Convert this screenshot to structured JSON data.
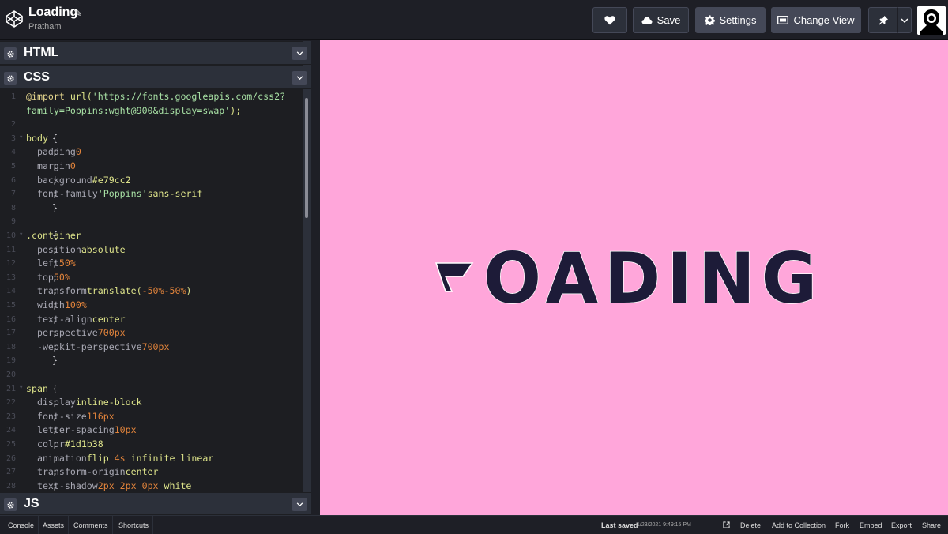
{
  "app": {
    "title": "Loading",
    "author": "Pratham"
  },
  "toolbar": {
    "save_label": "Save",
    "settings_label": "Settings",
    "change_view_label": "Change View"
  },
  "panels": {
    "html_label": "HTML",
    "css_label": "CSS",
    "js_label": "JS"
  },
  "css_code": [
    {
      "n": "1",
      "fold": "",
      "parts": [
        [
          "kw",
          "@import "
        ],
        [
          "sel",
          "url("
        ],
        [
          "str",
          "'https://fonts.googleapis.com/css2?"
        ]
      ]
    },
    {
      "n": "",
      "fold": "",
      "parts": [
        [
          "str",
          "family=Poppins:wght@900&display=swap'"
        ],
        [
          "sel",
          ");"
        ]
      ]
    },
    {
      "n": "2",
      "fold": "",
      "parts": []
    },
    {
      "n": "3",
      "fold": "▾",
      "parts": [
        [
          "sel",
          "body "
        ],
        [
          "txt",
          "{"
        ]
      ]
    },
    {
      "n": "4",
      "fold": "",
      "parts": [
        [
          "prop",
          "  padding"
        ],
        [
          "txt",
          ": "
        ],
        [
          "num",
          "0"
        ],
        [
          "txt",
          ";"
        ]
      ]
    },
    {
      "n": "5",
      "fold": "",
      "parts": [
        [
          "prop",
          "  margin"
        ],
        [
          "txt",
          ": "
        ],
        [
          "num",
          "0"
        ],
        [
          "txt",
          ";"
        ]
      ]
    },
    {
      "n": "6",
      "fold": "",
      "parts": [
        [
          "prop",
          "  background"
        ],
        [
          "txt",
          ": "
        ],
        [
          "sel",
          "#e79cc2"
        ],
        [
          "txt",
          ";"
        ]
      ]
    },
    {
      "n": "7",
      "fold": "",
      "parts": [
        [
          "prop",
          "  font-family"
        ],
        [
          "txt",
          ": "
        ],
        [
          "str",
          "'Poppins'"
        ],
        [
          "txt",
          ", "
        ],
        [
          "sel",
          "sans-serif"
        ],
        [
          "txt",
          ";"
        ]
      ]
    },
    {
      "n": "8",
      "fold": "",
      "parts": [
        [
          "txt",
          "}"
        ]
      ]
    },
    {
      "n": "9",
      "fold": "",
      "parts": []
    },
    {
      "n": "10",
      "fold": "▾",
      "parts": [
        [
          "sel",
          ".container "
        ],
        [
          "txt",
          "{"
        ]
      ]
    },
    {
      "n": "11",
      "fold": "",
      "parts": [
        [
          "prop",
          "  position"
        ],
        [
          "txt",
          ": "
        ],
        [
          "sel",
          "absolute"
        ],
        [
          "txt",
          ";"
        ]
      ]
    },
    {
      "n": "12",
      "fold": "",
      "parts": [
        [
          "prop",
          "  left"
        ],
        [
          "txt",
          ": "
        ],
        [
          "num",
          "50%"
        ],
        [
          "txt",
          ";"
        ]
      ]
    },
    {
      "n": "13",
      "fold": "",
      "parts": [
        [
          "prop",
          "  top"
        ],
        [
          "txt",
          ": "
        ],
        [
          "num",
          "50%"
        ],
        [
          "txt",
          ";"
        ]
      ]
    },
    {
      "n": "14",
      "fold": "",
      "parts": [
        [
          "prop",
          "  transform"
        ],
        [
          "txt",
          ": "
        ],
        [
          "sel",
          "translate("
        ],
        [
          "num",
          "-50%"
        ],
        [
          "txt",
          ", "
        ],
        [
          "num",
          "-50%"
        ],
        [
          "sel",
          ")"
        ],
        [
          "txt",
          ";"
        ]
      ]
    },
    {
      "n": "15",
      "fold": "",
      "parts": [
        [
          "prop",
          "  width"
        ],
        [
          "txt",
          ": "
        ],
        [
          "num",
          "100%"
        ],
        [
          "txt",
          ";"
        ]
      ]
    },
    {
      "n": "16",
      "fold": "",
      "parts": [
        [
          "prop",
          "  text-align"
        ],
        [
          "txt",
          ": "
        ],
        [
          "sel",
          "center"
        ],
        [
          "txt",
          ";"
        ]
      ]
    },
    {
      "n": "17",
      "fold": "",
      "parts": [
        [
          "prop",
          "  perspective"
        ],
        [
          "txt",
          ": "
        ],
        [
          "num",
          "700px"
        ],
        [
          "txt",
          ";"
        ]
      ]
    },
    {
      "n": "18",
      "fold": "",
      "parts": [
        [
          "prop",
          "  -webkit-perspective"
        ],
        [
          "txt",
          ": "
        ],
        [
          "num",
          "700px"
        ],
        [
          "txt",
          ";"
        ]
      ]
    },
    {
      "n": "19",
      "fold": "",
      "parts": [
        [
          "txt",
          "}"
        ]
      ]
    },
    {
      "n": "20",
      "fold": "",
      "parts": []
    },
    {
      "n": "21",
      "fold": "▾",
      "parts": [
        [
          "sel",
          "span "
        ],
        [
          "txt",
          "{"
        ]
      ]
    },
    {
      "n": "22",
      "fold": "",
      "parts": [
        [
          "prop",
          "  display"
        ],
        [
          "txt",
          ": "
        ],
        [
          "sel",
          "inline-block"
        ],
        [
          "txt",
          ";"
        ]
      ]
    },
    {
      "n": "23",
      "fold": "",
      "parts": [
        [
          "prop",
          "  font-size"
        ],
        [
          "txt",
          ": "
        ],
        [
          "num",
          "116px"
        ],
        [
          "txt",
          ";"
        ]
      ]
    },
    {
      "n": "24",
      "fold": "",
      "parts": [
        [
          "prop",
          "  letter-spacing"
        ],
        [
          "txt",
          ": "
        ],
        [
          "num",
          "10px"
        ],
        [
          "txt",
          ";"
        ]
      ]
    },
    {
      "n": "25",
      "fold": "",
      "parts": [
        [
          "prop",
          "  color"
        ],
        [
          "txt",
          ": "
        ],
        [
          "sel",
          "#1d1b38"
        ],
        [
          "txt",
          ";"
        ]
      ]
    },
    {
      "n": "26",
      "fold": "",
      "parts": [
        [
          "prop",
          "  animation"
        ],
        [
          "txt",
          ": "
        ],
        [
          "sel",
          "flip "
        ],
        [
          "num",
          "4s "
        ],
        [
          "sel",
          "infinite linear"
        ],
        [
          "txt",
          ";"
        ]
      ]
    },
    {
      "n": "27",
      "fold": "",
      "parts": [
        [
          "prop",
          "  transform-origin"
        ],
        [
          "txt",
          ": "
        ],
        [
          "sel",
          "center"
        ],
        [
          "txt",
          ";"
        ]
      ]
    },
    {
      "n": "28",
      "fold": "",
      "parts": [
        [
          "prop",
          "  text-shadow"
        ],
        [
          "txt",
          ": "
        ],
        [
          "num",
          "2px 2px 0px "
        ],
        [
          "sel",
          "white"
        ],
        [
          "txt",
          ";"
        ]
      ]
    }
  ],
  "preview": {
    "background": "#ffa6da",
    "text": "OADING",
    "text_color": "#1d1b38"
  },
  "footer": {
    "left": [
      "Console",
      "Assets",
      "Comments",
      "Shortcuts"
    ],
    "last_saved_label": "Last saved",
    "last_saved_value": "1/23/2021 9:49:15 PM",
    "right": [
      "Delete",
      "Add to Collection",
      "Fork",
      "Embed",
      "Export",
      "Share"
    ]
  }
}
